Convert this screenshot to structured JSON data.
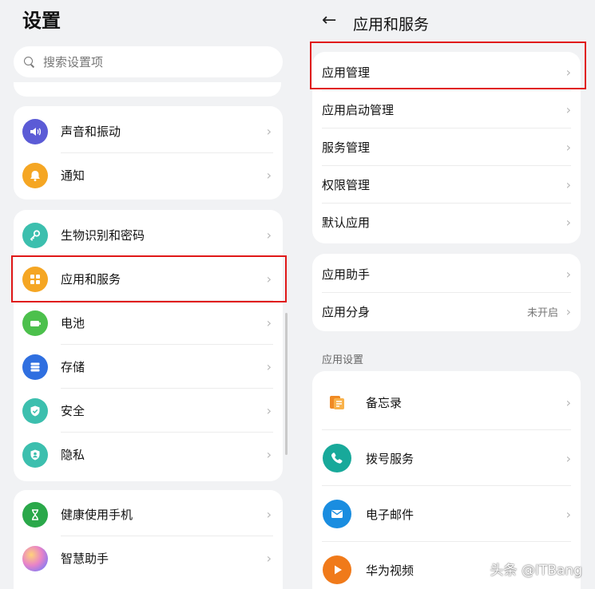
{
  "left": {
    "title": "设置",
    "search_placeholder": "搜索设置项",
    "cards": [
      {
        "items": [
          {
            "label": "声音和振动",
            "icon": "speaker-icon",
            "color": "#5b5bd6"
          },
          {
            "label": "通知",
            "icon": "bell-icon",
            "color": "#f5a623"
          }
        ]
      },
      {
        "items": [
          {
            "label": "生物识别和密码",
            "icon": "key-icon",
            "color": "#3cbfae"
          },
          {
            "label": "应用和服务",
            "icon": "apps-grid-icon",
            "color": "#f5a623"
          },
          {
            "label": "电池",
            "icon": "battery-icon",
            "color": "#4cc04c"
          },
          {
            "label": "存储",
            "icon": "storage-icon",
            "color": "#2f6fe0"
          },
          {
            "label": "安全",
            "icon": "shield-icon",
            "color": "#3cbfae"
          },
          {
            "label": "隐私",
            "icon": "privacy-icon",
            "color": "#3cbfae"
          }
        ]
      },
      {
        "items": [
          {
            "label": "健康使用手机",
            "icon": "hourglass-icon",
            "color": "#2aa84a"
          },
          {
            "label": "智慧助手",
            "icon": "assistant-orb-icon",
            "color": "#c77be0"
          }
        ]
      }
    ]
  },
  "right": {
    "back_icon": "back-arrow-icon",
    "title": "应用和服务",
    "group1": [
      "应用管理",
      "应用启动管理",
      "服务管理",
      "权限管理",
      "默认应用"
    ],
    "group2": [
      {
        "label": "应用助手",
        "value": ""
      },
      {
        "label": "应用分身",
        "value": "未开启"
      }
    ],
    "section_title": "应用设置",
    "apps": [
      {
        "label": "备忘录",
        "icon": "notes-icon",
        "color": "#f08a24"
      },
      {
        "label": "拨号服务",
        "icon": "phone-icon",
        "color": "#18a99a"
      },
      {
        "label": "电子邮件",
        "icon": "email-icon",
        "color": "#1a8de0"
      },
      {
        "label": "华为视频",
        "icon": "video-play-icon",
        "color": "#f07a1a"
      }
    ]
  },
  "highlight_color": "#e01818",
  "watermark": "头条 @ITBang"
}
